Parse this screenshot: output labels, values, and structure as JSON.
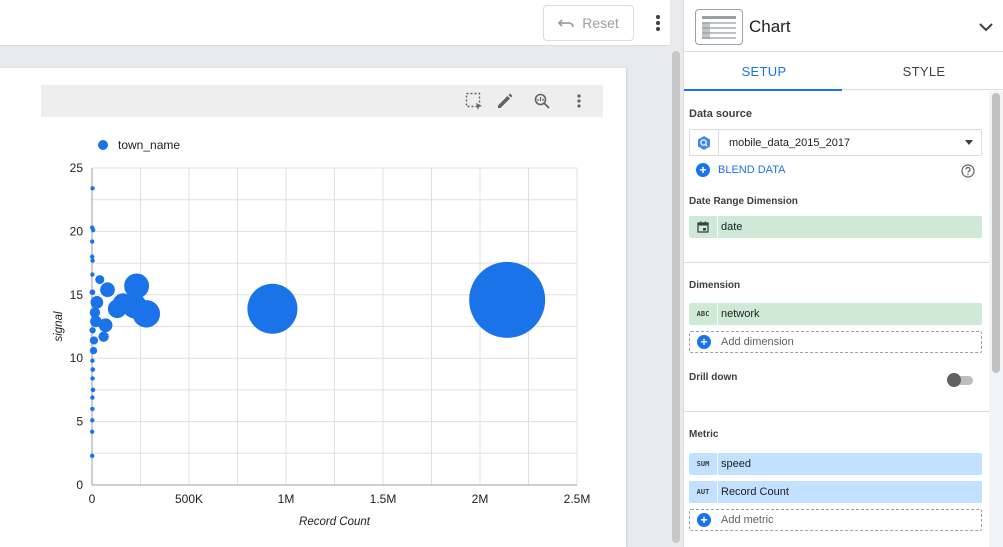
{
  "toolbar": {
    "reset_label": "Reset"
  },
  "panel": {
    "title": "Chart",
    "tabs": [
      {
        "label": "SETUP",
        "active": true
      },
      {
        "label": "STYLE",
        "active": false
      }
    ],
    "data_source": {
      "label": "Data source",
      "value": "mobile_data_2015_2017",
      "blend_label": "BLEND DATA"
    },
    "date_range": {
      "label": "Date Range Dimension",
      "field": "date"
    },
    "dimension": {
      "label": "Dimension",
      "field": {
        "type": "ABC",
        "name": "network"
      },
      "add_label": "Add dimension"
    },
    "drill_down": {
      "label": "Drill down",
      "enabled": false
    },
    "metric": {
      "label": "Metric",
      "fields": [
        {
          "type": "SUM",
          "name": "speed"
        },
        {
          "type": "AUT",
          "name": "Record Count"
        }
      ],
      "add_label": "Add metric"
    }
  },
  "colors": {
    "accent": "#1a73e8",
    "dimension_chip": "#ceead6",
    "metric_chip": "#c2e0ff"
  },
  "chart_data": {
    "type": "scatter",
    "legend": [
      "town_name"
    ],
    "xlabel": "Record Count",
    "ylabel": "signal",
    "xlim": [
      0,
      2500000
    ],
    "ylim": [
      0,
      25
    ],
    "x_ticks": [
      {
        "value": 0,
        "label": "0"
      },
      {
        "value": 500000,
        "label": "500K"
      },
      {
        "value": 1000000,
        "label": "1M"
      },
      {
        "value": 1500000,
        "label": "1.5M"
      },
      {
        "value": 2000000,
        "label": "2M"
      },
      {
        "value": 2500000,
        "label": "2.5M"
      }
    ],
    "y_ticks": [
      {
        "value": 0,
        "label": "0"
      },
      {
        "value": 5,
        "label": "5"
      },
      {
        "value": 10,
        "label": "10"
      },
      {
        "value": 15,
        "label": "15"
      },
      {
        "value": 20,
        "label": "20"
      },
      {
        "value": 25,
        "label": "25"
      }
    ],
    "grid": true,
    "legend_position": "top-left",
    "bubble_color": "#1a73e8",
    "points": [
      {
        "x": 2140000,
        "y": 14.6,
        "size": 2140000
      },
      {
        "x": 930000,
        "y": 13.9,
        "size": 930000
      },
      {
        "x": 280000,
        "y": 13.5,
        "size": 280000
      },
      {
        "x": 230000,
        "y": 15.7,
        "size": 230000
      },
      {
        "x": 220000,
        "y": 14.1,
        "size": 220000
      },
      {
        "x": 160000,
        "y": 14.3,
        "size": 160000
      },
      {
        "x": 130000,
        "y": 13.9,
        "size": 130000
      },
      {
        "x": 80000,
        "y": 15.4,
        "size": 80000
      },
      {
        "x": 70000,
        "y": 12.6,
        "size": 70000
      },
      {
        "x": 60000,
        "y": 11.7,
        "size": 40000
      },
      {
        "x": 40000,
        "y": 16.2,
        "size": 30000
      },
      {
        "x": 25000,
        "y": 14.4,
        "size": 60000
      },
      {
        "x": 20000,
        "y": 12.9,
        "size": 50000
      },
      {
        "x": 15000,
        "y": 13.6,
        "size": 40000
      },
      {
        "x": 10000,
        "y": 11.4,
        "size": 25000
      },
      {
        "x": 8000,
        "y": 10.6,
        "size": 20000
      },
      {
        "x": 6000,
        "y": 20.1,
        "size": 4000
      },
      {
        "x": 3000,
        "y": 23.4,
        "size": 1000
      },
      {
        "x": 3000,
        "y": 17.7,
        "size": 2000
      },
      {
        "x": 2000,
        "y": 16.6,
        "size": 3000
      },
      {
        "x": 4000,
        "y": 9.1,
        "size": 8000
      },
      {
        "x": 3000,
        "y": 8.4,
        "size": 6000
      },
      {
        "x": 5000,
        "y": 7.5,
        "size": 8000
      },
      {
        "x": 2000,
        "y": 6.9,
        "size": 4000
      },
      {
        "x": 2000,
        "y": 6.0,
        "size": 3000
      },
      {
        "x": 1500,
        "y": 5.1,
        "size": 2000
      },
      {
        "x": 1000,
        "y": 4.2,
        "size": 1500
      },
      {
        "x": 1000,
        "y": 2.3,
        "size": 1000
      },
      {
        "x": 1000,
        "y": 19.2,
        "size": 1000
      },
      {
        "x": 1000,
        "y": 18.0,
        "size": 1000
      },
      {
        "x": 2000,
        "y": 9.8,
        "size": 6000
      },
      {
        "x": 3000,
        "y": 12.2,
        "size": 15000
      },
      {
        "x": 2000,
        "y": 15.2,
        "size": 12000
      },
      {
        "x": 1000,
        "y": 20.3,
        "size": 800
      }
    ]
  }
}
